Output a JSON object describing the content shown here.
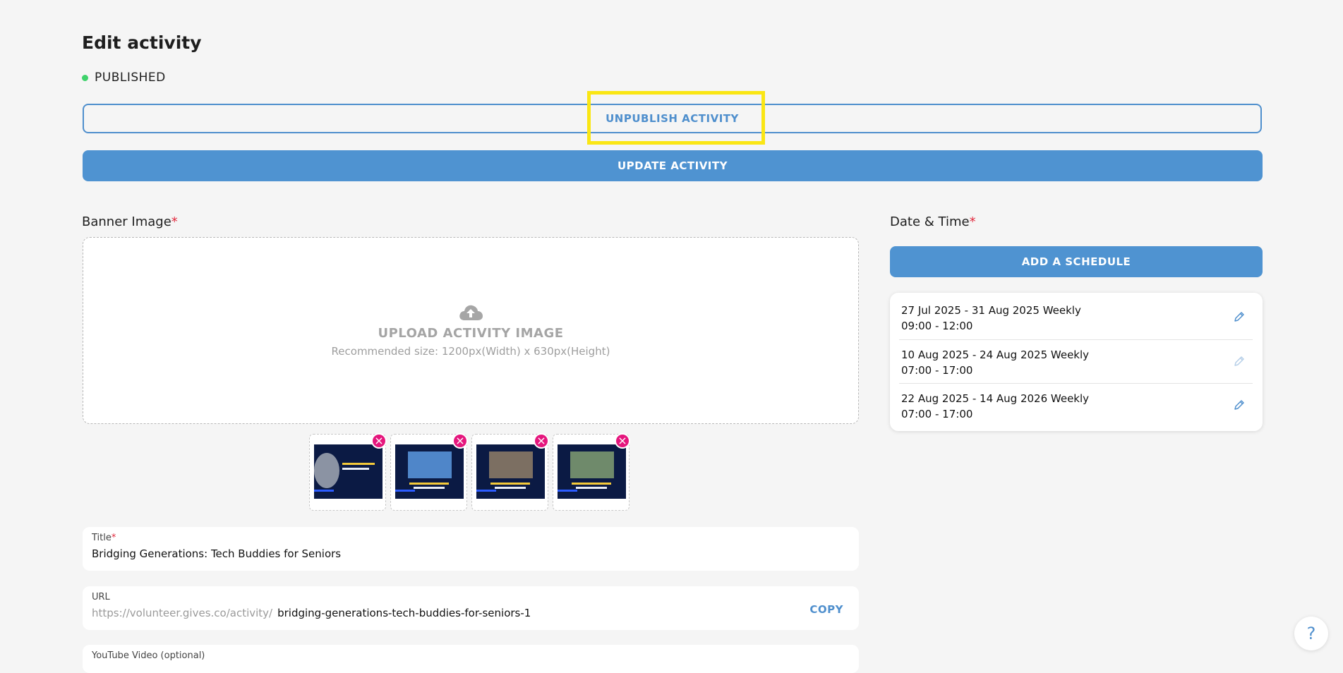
{
  "page": {
    "title": "Edit activity",
    "status": "PUBLISHED"
  },
  "actions": {
    "unpublish_label": "UNPUBLISH ACTIVITY",
    "update_label": "UPDATE ACTIVITY"
  },
  "banner": {
    "label": "Banner Image",
    "required_mark": "*",
    "upload_title": "UPLOAD ACTIVITY IMAGE",
    "upload_hint": "Recommended size: 1200px(Width) x 630px(Height)",
    "thumbnails": [
      {
        "remove_label": "×"
      },
      {
        "remove_label": "×"
      },
      {
        "remove_label": "×"
      },
      {
        "remove_label": "×"
      }
    ]
  },
  "title_field": {
    "label": "Title",
    "required_mark": "*",
    "value": "Bridging Generations: Tech Buddies for Seniors"
  },
  "url_field": {
    "label": "URL",
    "prefix": "https://volunteer.gives.co/activity/",
    "value": "bridging-generations-tech-buddies-for-seniors-1",
    "copy_label": "COPY"
  },
  "youtube_field": {
    "label": "YouTube Video (optional)"
  },
  "schedule": {
    "label": "Date & Time",
    "required_mark": "*",
    "add_label": "ADD A SCHEDULE",
    "items": [
      {
        "dates": "27 Jul 2025 - 31 Aug 2025 Weekly",
        "times": "09:00 - 12:00"
      },
      {
        "dates": "10 Aug 2025 - 24 Aug 2025 Weekly",
        "times": "07:00 - 17:00"
      },
      {
        "dates": "22 Aug 2025 - 14 Aug 2026 Weekly",
        "times": "07:00 - 17:00"
      }
    ]
  },
  "help": {
    "label": "?"
  },
  "colors": {
    "accent": "#4f93d1",
    "status_green": "#3fd26b",
    "remove": "#e5167d",
    "highlight": "#fae614"
  }
}
